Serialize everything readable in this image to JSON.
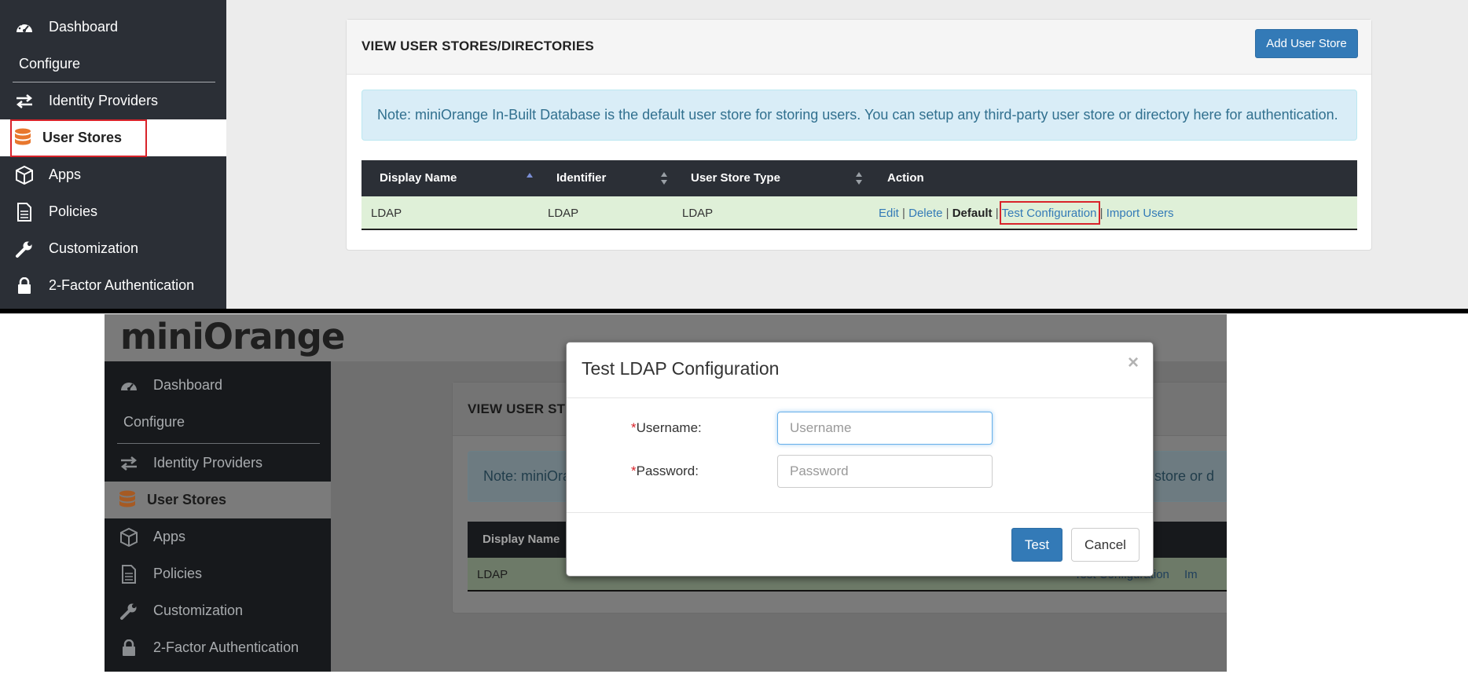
{
  "sidebar": {
    "items": [
      {
        "label": "Dashboard",
        "icon": "dashboard-gauge-icon"
      },
      {
        "label": "Identity Providers",
        "icon": "arrows-exchange-icon"
      },
      {
        "label": "User Stores",
        "icon": "database-icon"
      },
      {
        "label": "Apps",
        "icon": "cube-icon"
      },
      {
        "label": "Policies",
        "icon": "document-icon"
      },
      {
        "label": "Customization",
        "icon": "wrench-icon"
      },
      {
        "label": "2-Factor Authentication",
        "icon": "lock-icon"
      }
    ],
    "section_label": "Configure",
    "active": "User Stores"
  },
  "page": {
    "title": "VIEW USER STORES/DIRECTORIES",
    "add_button": "Add User Store",
    "note": "Note: miniOrange In-Built Database is the default user store for storing users. You can setup any third-party user store or directory here for authentication."
  },
  "table": {
    "headers": [
      "Display Name",
      "Identifier",
      "User Store Type",
      "Action"
    ],
    "rows": [
      {
        "display_name": "LDAP",
        "identifier": "LDAP",
        "type": "LDAP",
        "actions": {
          "edit": "Edit",
          "delete": "Delete",
          "default": "Default",
          "test": "Test Configuration",
          "import": "Import Users",
          "separator": "|"
        }
      }
    ]
  },
  "bottom": {
    "logo": "miniOrange",
    "card_title_visible": "VIEW USER ST",
    "note_visible": "Note: miniOra",
    "note_visible_right": "er store or d",
    "header_visible": "Display Name",
    "row_visible": "LDAP",
    "row_action_visible": "Test Configuration",
    "row_action_visible2": "Im"
  },
  "modal": {
    "title": "Test LDAP Configuration",
    "close": "×",
    "username_label": "Username:",
    "password_label": "Password:",
    "required_mark": "*",
    "username_placeholder": "Username",
    "password_placeholder": "Password",
    "test_button": "Test",
    "cancel_button": "Cancel"
  },
  "colors": {
    "sidebar_bg": "#2b2f36",
    "primary": "#337ab7",
    "note_bg": "#d9edf7",
    "row_bg": "#dff0d8",
    "highlight": "#d9232a",
    "logo_accent": "#e8772e"
  }
}
